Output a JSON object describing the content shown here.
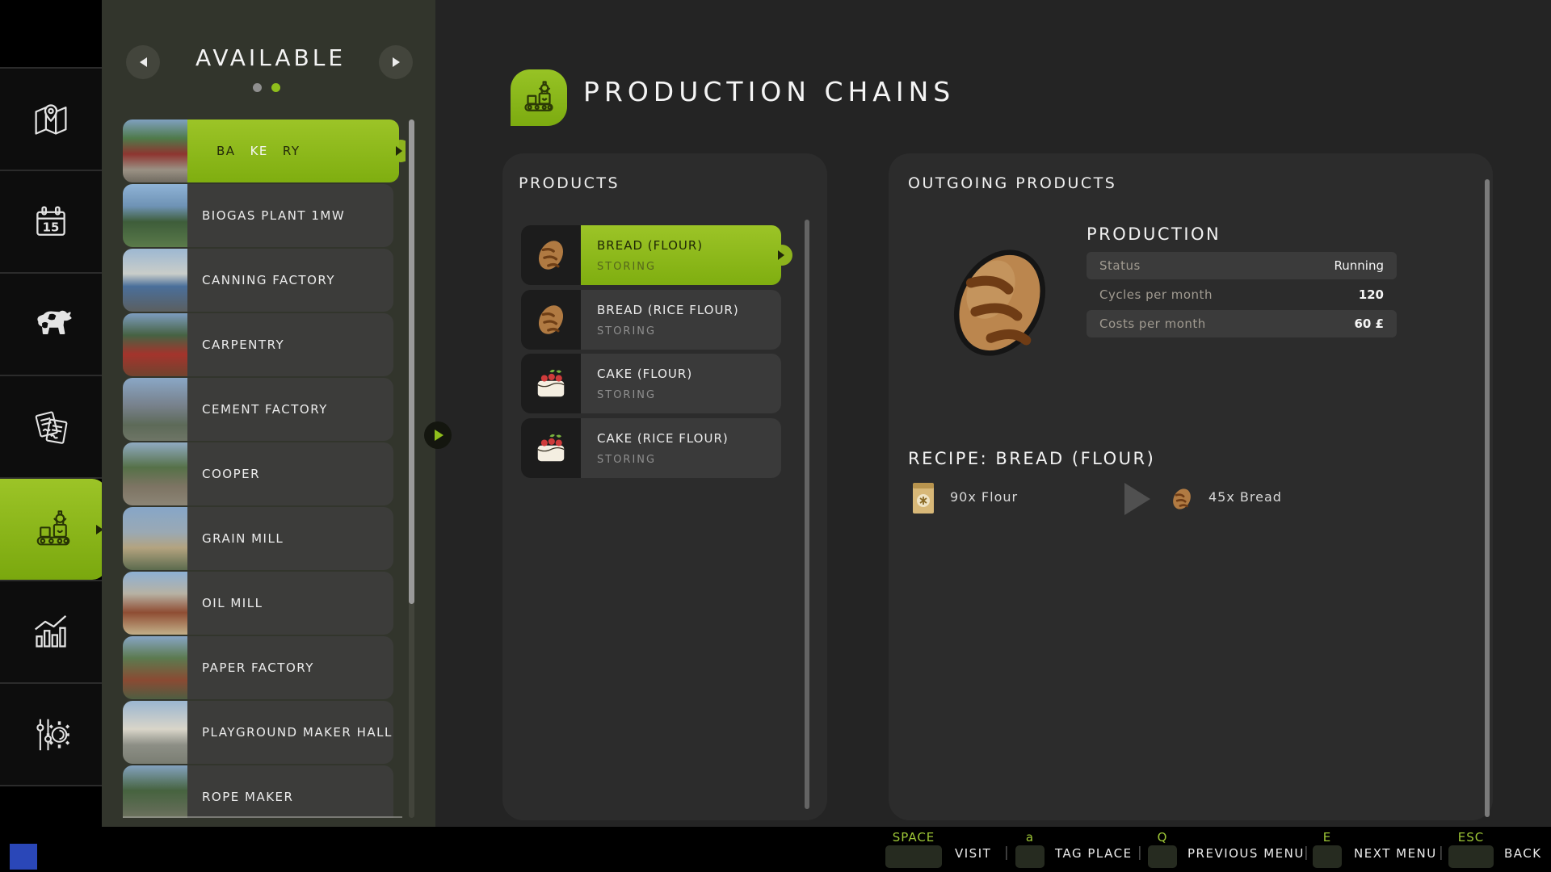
{
  "colors": {
    "accent_green": "#8fbe1c",
    "key_green": "#9dc636",
    "panel_olive": "#32352c"
  },
  "nav_rail": {
    "items": [
      "map",
      "calendar",
      "animals",
      "contracts",
      "production-chains",
      "statistics",
      "settings"
    ],
    "active": "production-chains"
  },
  "available_panel": {
    "title": "AVAILABLE",
    "pagination": {
      "dots": 2,
      "active_index": 1
    },
    "buildings": [
      {
        "label": "BAKERY",
        "pre": "BA",
        "match": "KE",
        "post": "RY",
        "selected": true
      },
      {
        "label": "BIOGAS PLANT 1MW"
      },
      {
        "label": "CANNING FACTORY"
      },
      {
        "label": "CARPENTRY"
      },
      {
        "label": "CEMENT FACTORY"
      },
      {
        "label": "COOPER"
      },
      {
        "label": "GRAIN MILL"
      },
      {
        "label": "OIL MILL"
      },
      {
        "label": "PAPER FACTORY"
      },
      {
        "label": "PLAYGROUND MAKER HALL"
      },
      {
        "label": "ROPE MAKER"
      }
    ]
  },
  "header": {
    "title": "PRODUCTION CHAINS"
  },
  "products_panel": {
    "title": "PRODUCTS",
    "items": [
      {
        "name": "BREAD (FLOUR)",
        "status": "STORING",
        "icon": "bread-icon",
        "selected": true
      },
      {
        "name": "BREAD (RICE FLOUR)",
        "status": "STORING",
        "icon": "bread-icon"
      },
      {
        "name": "CAKE (FLOUR)",
        "status": "STORING",
        "icon": "cake-icon"
      },
      {
        "name": "CAKE (RICE FLOUR)",
        "status": "STORING",
        "icon": "cake-icon"
      }
    ]
  },
  "outgoing_panel": {
    "title": "OUTGOING PRODUCTS",
    "production": {
      "title": "PRODUCTION",
      "rows": [
        {
          "label": "Status",
          "value": "Running"
        },
        {
          "label": "Cycles per month",
          "value": "120"
        },
        {
          "label": "Costs per month",
          "value": "60 £"
        }
      ]
    },
    "recipe": {
      "title": "RECIPE: BREAD (FLOUR)",
      "input": "90x Flour",
      "output": "45x Bread"
    }
  },
  "hotbar": {
    "actions": [
      {
        "key": "SPACE",
        "label": "VISIT"
      },
      {
        "key": "a",
        "label": "TAG PLACE"
      },
      {
        "key": "Q",
        "label": "PREVIOUS MENU"
      },
      {
        "key": "E",
        "label": "NEXT MENU"
      },
      {
        "key": "ESC",
        "label": "BACK"
      }
    ]
  }
}
